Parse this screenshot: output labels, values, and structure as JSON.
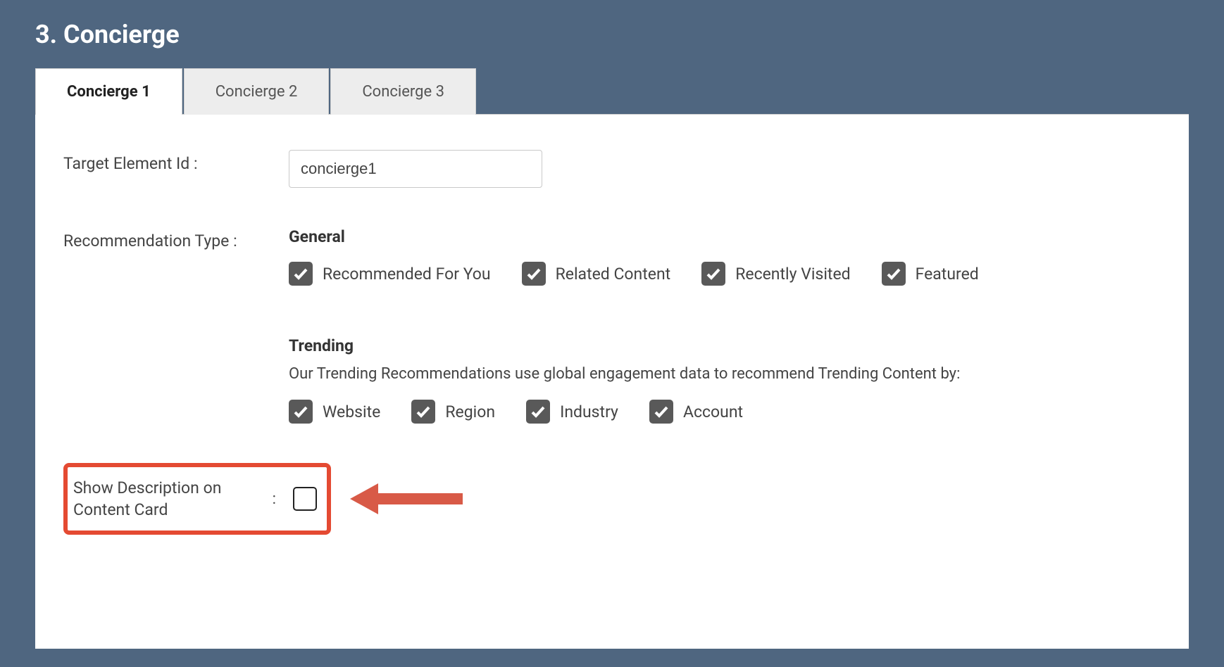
{
  "section_title": "3. Concierge",
  "tabs": [
    {
      "label": "Concierge 1",
      "active": true
    },
    {
      "label": "Concierge 2",
      "active": false
    },
    {
      "label": "Concierge 3",
      "active": false
    }
  ],
  "target_element": {
    "label": "Target Element Id",
    "value": "concierge1"
  },
  "recommendation_type": {
    "label": "Recommendation Type",
    "general": {
      "heading": "General",
      "options": [
        {
          "label": "Recommended For You",
          "checked": true
        },
        {
          "label": "Related Content",
          "checked": true
        },
        {
          "label": "Recently Visited",
          "checked": true
        },
        {
          "label": "Featured",
          "checked": true
        }
      ]
    },
    "trending": {
      "heading": "Trending",
      "description": "Our Trending Recommendations use global engagement data to recommend Trending Content by:",
      "options": [
        {
          "label": "Website",
          "checked": true
        },
        {
          "label": "Region",
          "checked": true
        },
        {
          "label": "Industry",
          "checked": true
        },
        {
          "label": "Account",
          "checked": true
        }
      ]
    }
  },
  "show_description": {
    "label": "Show Description on Content Card",
    "checked": false
  },
  "annotation": {
    "highlight_color": "#e44a32",
    "arrow_direction": "left"
  }
}
